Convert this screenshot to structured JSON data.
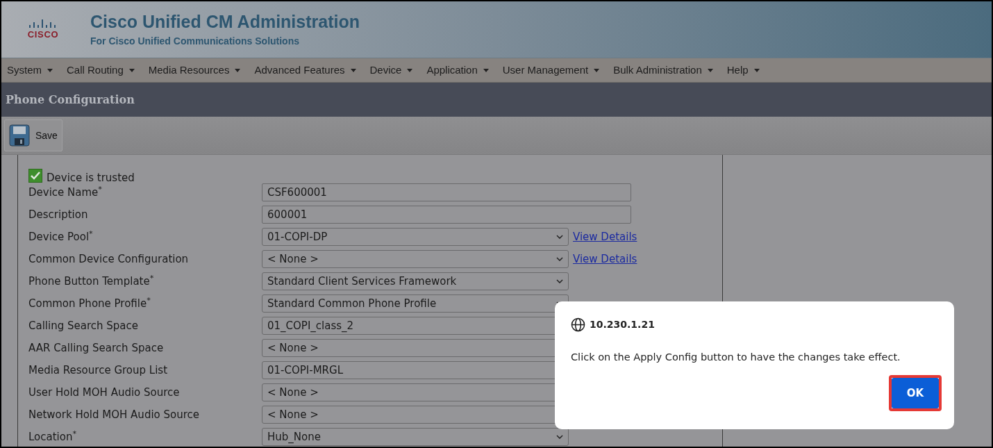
{
  "header": {
    "logo": "CISCO",
    "title": "Cisco Unified CM Administration",
    "subtitle": "For Cisco Unified Communications Solutions"
  },
  "menu": [
    "System",
    "Call Routing",
    "Media Resources",
    "Advanced Features",
    "Device",
    "Application",
    "User Management",
    "Bulk Administration",
    "Help"
  ],
  "page_title": "Phone Configuration",
  "toolbar": {
    "save": "Save"
  },
  "trusted": {
    "label": "Device is trusted",
    "checked": true
  },
  "fields": [
    {
      "label": "Device Name$^{*}$",
      "kind": "text",
      "value": "CSF600001"
    },
    {
      "label": "Description",
      "kind": "text",
      "value": "600001"
    },
    {
      "label": "Device Pool$^{*}$",
      "kind": "select",
      "value": "01-COPI-DP",
      "link": "View Details"
    },
    {
      "label": "Common Device Configuration",
      "kind": "select",
      "value": "< None >",
      "link": "View Details"
    },
    {
      "label": "Phone Button Template$^{*}$",
      "kind": "select",
      "value": "Standard Client Services Framework"
    },
    {
      "label": "Common Phone Profile$^{*}$",
      "kind": "select",
      "value": "Standard Common Phone Profile"
    },
    {
      "label": "Calling Search Space",
      "kind": "select",
      "value": "01_COPI_class_2"
    },
    {
      "label": "AAR Calling Search Space",
      "kind": "select",
      "value": "< None >"
    },
    {
      "label": "Media Resource Group List",
      "kind": "select",
      "value": "01-COPI-MRGL"
    },
    {
      "label": "User Hold MOH Audio Source",
      "kind": "select",
      "value": "< None >"
    },
    {
      "label": "Network Hold MOH Audio Source",
      "kind": "select",
      "value": "< None >"
    },
    {
      "label": "Location$^{*}$",
      "kind": "select",
      "value": "Hub_None"
    }
  ],
  "dialog": {
    "origin": "10.230.1.21",
    "message": "Click on the Apply Config button to have the changes take effect.",
    "button": "OK"
  }
}
